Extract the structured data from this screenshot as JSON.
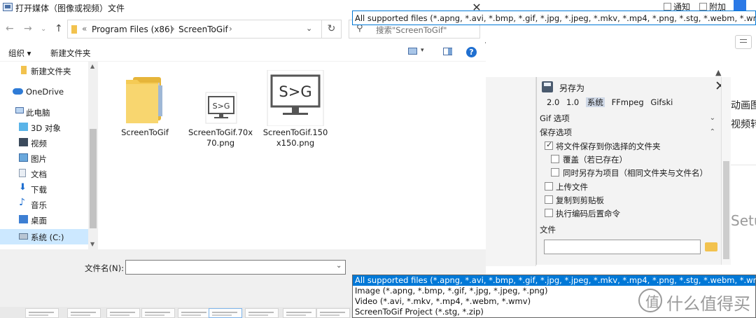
{
  "window": {
    "title": "打开媒体（图像或视频）文件"
  },
  "nav": {
    "path": [
      "Program Files (x86)",
      "ScreenToGif"
    ],
    "search_placeholder": "搜索\"ScreenToGif\""
  },
  "toolbar": {
    "organize": "组织 ▾",
    "new_folder": "新建文件夹"
  },
  "sidebar": {
    "items": [
      {
        "label": "新建文件夹",
        "icon": "folder-icon"
      },
      {
        "label": "OneDrive",
        "icon": "cloud-icon"
      },
      {
        "label": "此电脑",
        "icon": "computer-icon"
      },
      {
        "label": "3D 对象",
        "icon": "cube-icon"
      },
      {
        "label": "视频",
        "icon": "video-icon"
      },
      {
        "label": "图片",
        "icon": "picture-icon"
      },
      {
        "label": "文档",
        "icon": "document-icon"
      },
      {
        "label": "下载",
        "icon": "download-icon"
      },
      {
        "label": "音乐",
        "icon": "music-icon"
      },
      {
        "label": "桌面",
        "icon": "desktop-icon"
      },
      {
        "label": "系统 (C:)",
        "icon": "drive-icon",
        "selected": true
      }
    ]
  },
  "files": [
    {
      "name": "ScreenToGif",
      "type": "folder"
    },
    {
      "name": "ScreenToGif.70x70.png",
      "type": "image"
    },
    {
      "name": "ScreenToGif.150x150.png",
      "type": "image"
    }
  ],
  "bottom": {
    "filename_label": "文件名(N):",
    "filename_value": "",
    "filetype_selected": "All supported files (*.apng, *.avi, *.bmp, *.gif, *.jpg, *.jpeg, *.mkv, *.mp4, *.png, *.stg, *.webm, *.wmv, *.zip)",
    "filetype_options": [
      "All supported files (*.apng, *.avi, *.bmp, *.gif, *.jpg, *.jpeg, *.mkv, *.mp4, *.png, *.stg, *.webm, *.wmv, *.zip)",
      "Image (*.apng, *.bmp, *.gif, *.jpg, *.jpeg, *.png)",
      "Video (*.avi, *.mkv, *.mp4, *.webm, *.wmv)",
      "ScreenToGif Project (*.stg, *.zip)"
    ]
  },
  "saveas": {
    "title": "另存为",
    "tabs": [
      "2.0",
      "1.0",
      "系统",
      "FFmpeg",
      "Gifski"
    ],
    "active_tab": "系统",
    "section_gif": "Gif 选项",
    "section_save": "保存选项",
    "options": [
      {
        "label": "将文件保存到你选择的文件夹",
        "checked": true
      },
      {
        "label": "覆盖（若已存在）",
        "checked": false
      },
      {
        "label": "同时另存为项目（相同文件夹与文件名）",
        "checked": false
      },
      {
        "label": "上传文件",
        "checked": false
      },
      {
        "label": "复制到剪贴板",
        "checked": false
      },
      {
        "label": "执行编码后置命令",
        "checked": false
      }
    ],
    "file_label": "文件"
  },
  "background": {
    "notify": "通知",
    "attach": "附加",
    "partial_1": "动画图",
    "partial_2": "视频转",
    "partial_3": "Setu"
  },
  "watermark": {
    "text": "什么值得买"
  },
  "colors": {
    "accent": "#0078d7",
    "selection": "#cce8ff",
    "folder": "#f4c542"
  }
}
